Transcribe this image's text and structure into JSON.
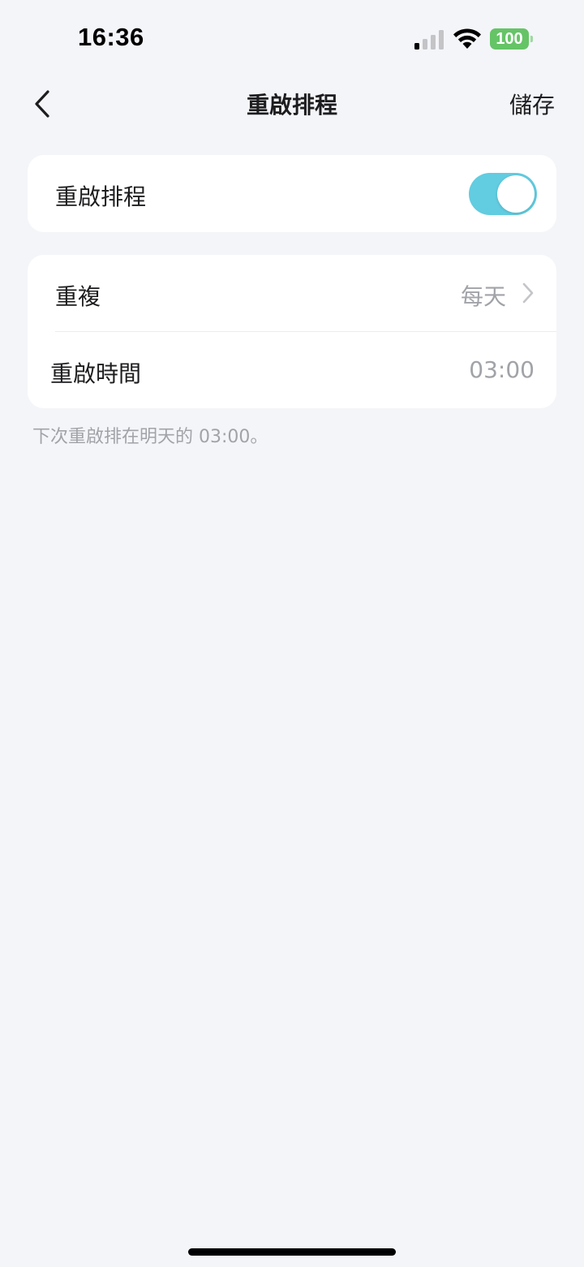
{
  "status_bar": {
    "time": "16:36",
    "battery_level": "100",
    "icons": [
      "signal-icon",
      "wifi-icon",
      "battery-icon"
    ]
  },
  "nav": {
    "back_icon": "chevron-left-icon",
    "title": "重啟排程",
    "save_label": "儲存"
  },
  "schedule_toggle": {
    "label": "重啟排程",
    "enabled": true,
    "color": "#62cce0"
  },
  "settings": {
    "repeat": {
      "label": "重複",
      "value": "每天",
      "icon": "chevron-right-icon"
    },
    "reboot_time": {
      "label": "重啟時間",
      "value": "03:00"
    }
  },
  "footnote": "下次重啟排在明天的 03:00。",
  "colors": {
    "background": "#f4f5f9",
    "card": "#ffffff",
    "secondary_text": "#a1a3a8",
    "battery": "#65c466"
  }
}
